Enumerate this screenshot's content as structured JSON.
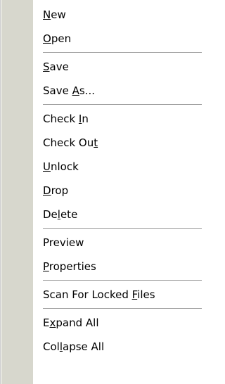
{
  "menu": {
    "groups": [
      {
        "items": [
          {
            "label": "New",
            "underline_index": 0
          },
          {
            "label": "Open",
            "underline_index": 0
          }
        ]
      },
      {
        "items": [
          {
            "label": "Save",
            "underline_index": 0
          },
          {
            "label": "Save As...",
            "underline_index": 5
          }
        ]
      },
      {
        "items": [
          {
            "label": "Check In",
            "underline_index": 6
          },
          {
            "label": "Check Out",
            "underline_index": 8
          },
          {
            "label": "Unlock",
            "underline_index": 0
          },
          {
            "label": "Drop",
            "underline_index": 0
          },
          {
            "label": "Delete",
            "underline_index": 2
          }
        ]
      },
      {
        "items": [
          {
            "label": "Preview",
            "underline_index": -1
          },
          {
            "label": "Properties",
            "underline_index": 0
          }
        ]
      },
      {
        "items": [
          {
            "label": "Scan For Locked Files",
            "underline_index": 16
          }
        ]
      },
      {
        "items": [
          {
            "label": "Expand All",
            "underline_index": 1
          },
          {
            "label": "Collapse All",
            "underline_index": 3
          }
        ]
      }
    ]
  }
}
